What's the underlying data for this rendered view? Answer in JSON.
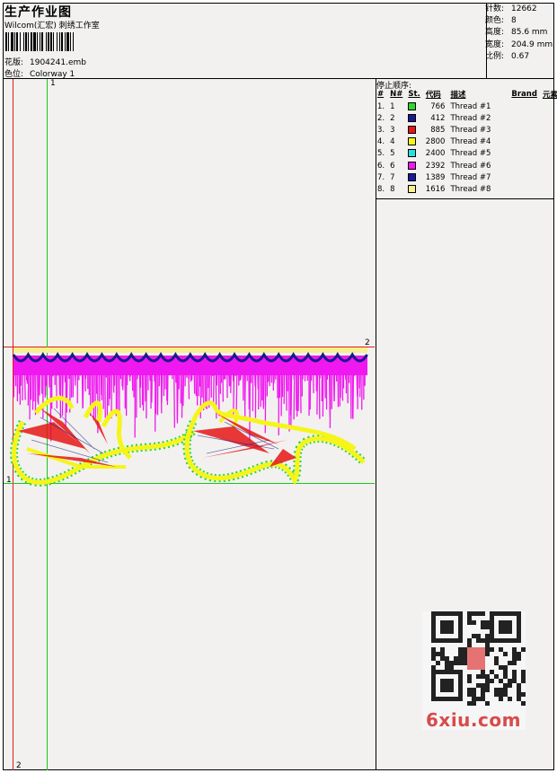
{
  "header": {
    "title": "生产作业图",
    "company": "Wilcom(汇宏) 刺绣工作室",
    "pattern_label": "花版:",
    "pattern_value": "1904241.emb",
    "colorway_label": "色位:",
    "colorway_value": "Colorway 1"
  },
  "stats": {
    "stitches_label": "针数:",
    "stitches_value": "12662",
    "colors_label": "颜色:",
    "colors_value": "8",
    "height_label": "高度:",
    "height_value": "85.6 mm",
    "width_label": "宽度:",
    "width_value": "204.9 mm",
    "scale_label": "比例:",
    "scale_value": "0.67"
  },
  "stop_sequence": {
    "title": "停止顺序:",
    "headers": [
      "#",
      "N#",
      "St.",
      "代码",
      "描述",
      "Brand",
      "元素"
    ],
    "rows": [
      {
        "idx": "1.",
        "n": "1",
        "color": "#2ed62e",
        "code": "766",
        "desc": "Thread #1"
      },
      {
        "idx": "2.",
        "n": "2",
        "color": "#1a1a8c",
        "code": "412",
        "desc": "Thread #2"
      },
      {
        "idx": "3.",
        "n": "3",
        "color": "#e51616",
        "code": "885",
        "desc": "Thread #3"
      },
      {
        "idx": "4.",
        "n": "4",
        "color": "#f5f51a",
        "code": "2800",
        "desc": "Thread #4"
      },
      {
        "idx": "5.",
        "n": "5",
        "color": "#29e0e0",
        "code": "2400",
        "desc": "Thread #5"
      },
      {
        "idx": "6.",
        "n": "6",
        "color": "#f018f0",
        "code": "2392",
        "desc": "Thread #6"
      },
      {
        "idx": "7.",
        "n": "7",
        "color": "#1a1a9a",
        "code": "1389",
        "desc": "Thread #7"
      },
      {
        "idx": "8.",
        "n": "8",
        "color": "#f7f090",
        "code": "1616",
        "desc": "Thread #8"
      }
    ]
  },
  "canvas": {
    "marker_green_top": "1",
    "marker_red_right": "2",
    "marker_green_left": "1",
    "marker_red_bottom": "2"
  },
  "colors": {
    "magenta": "#f018f0",
    "navy": "#1a1a8c",
    "yellow": "#f5f51a",
    "red": "#e51616",
    "green": "#2ed62e",
    "light_yellow": "#f7f090"
  },
  "watermark": {
    "text": "6xiu.com"
  }
}
